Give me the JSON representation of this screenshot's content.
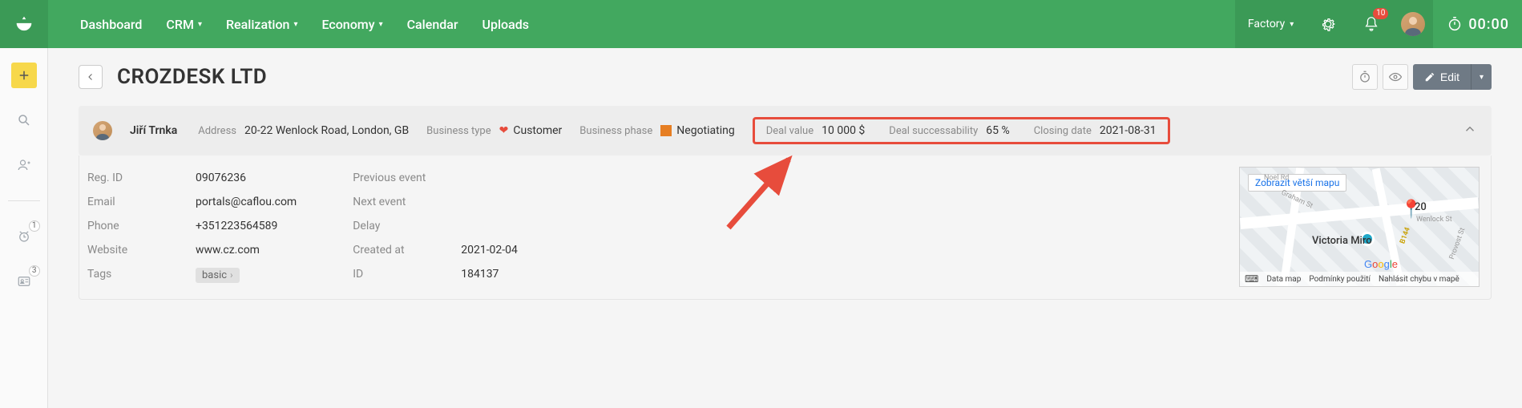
{
  "nav": {
    "dashboard": "Dashboard",
    "crm": "CRM",
    "realization": "Realization",
    "economy": "Economy",
    "calendar": "Calendar",
    "uploads": "Uploads"
  },
  "topRight": {
    "workspace": "Factory",
    "notifCount": "10",
    "timer": "00:00"
  },
  "sidebarBadges": {
    "clock": "1",
    "card": "3"
  },
  "page": {
    "title": "CROZDESK LTD",
    "editLabel": "Edit"
  },
  "summary": {
    "ownerName": "Jiří Trnka",
    "addressLabel": "Address",
    "addressValue": "20-22 Wenlock Road, London, GB",
    "businessTypeLabel": "Business type",
    "businessTypeValue": "Customer",
    "businessPhaseLabel": "Business phase",
    "businessPhaseValue": "Negotiating",
    "dealValueLabel": "Deal value",
    "dealValueValue": "10 000 $",
    "dealSuccessLabel": "Deal successability",
    "dealSuccessValue": "65 %",
    "closingDateLabel": "Closing date",
    "closingDateValue": "2021-08-31"
  },
  "details": {
    "col1": [
      {
        "label": "Reg. ID",
        "value": "09076236"
      },
      {
        "label": "Email",
        "value": "portals@caflou.com"
      },
      {
        "label": "Phone",
        "value": "+351223564589"
      },
      {
        "label": "Website",
        "value": "www.cz.com"
      },
      {
        "label": "Tags",
        "value": "basic",
        "tag": true
      }
    ],
    "col2": [
      {
        "label": "Previous event",
        "value": ""
      },
      {
        "label": "Next event",
        "value": ""
      },
      {
        "label": "Delay",
        "value": ""
      },
      {
        "label": "Created at",
        "value": "2021-02-04"
      },
      {
        "label": "ID",
        "value": "184137"
      }
    ]
  },
  "map": {
    "tooltip": "Zobrazit větší mapu",
    "pinLabel": "20",
    "place": "Victoria Miro",
    "street1": "Wenlock St",
    "street2": "Provost St",
    "street3": "Graham St",
    "street4": "Noel Rd",
    "street5": "B144",
    "footer": {
      "dataMap": "Data map",
      "terms": "Podmínky použití",
      "report": "Nahlásit chybu v mapě"
    }
  }
}
